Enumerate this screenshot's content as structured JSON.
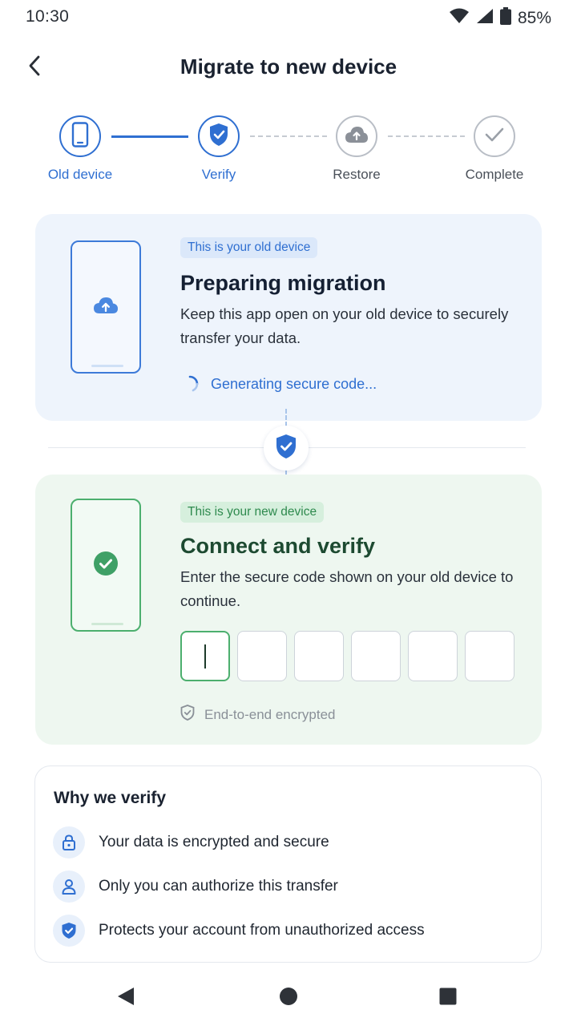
{
  "status_bar": {
    "time": "10:30",
    "battery_percent": "85%",
    "icons": [
      "wifi-icon",
      "signal-icon",
      "battery-icon"
    ]
  },
  "header": {
    "title": "Migrate to new device",
    "back_icon": "chevron-left-icon"
  },
  "stepper": {
    "steps": [
      {
        "label": "Old device",
        "state": "done",
        "icon": "phone-icon"
      },
      {
        "label": "Verify",
        "state": "active",
        "icon": "shield-check-icon"
      },
      {
        "label": "Restore",
        "state": "pending",
        "icon": "cloud-icon"
      },
      {
        "label": "Complete",
        "state": "pending",
        "icon": "check-icon"
      }
    ]
  },
  "old_device_card": {
    "badge": "This is your old device",
    "title": "Preparing migration",
    "description": "Keep this app open on your old device to securely transfer your data.",
    "progress_text": "Generating secure code..."
  },
  "new_device_card": {
    "badge": "This is your new device",
    "title": "Connect and verify",
    "description": "Enter the secure code shown on your old device to continue.",
    "code_length": 6,
    "code_values": [
      "",
      "",
      "",
      "",
      "",
      ""
    ],
    "encryption_note": "End-to-end encrypted"
  },
  "why_verify": {
    "title": "Why we verify",
    "items": [
      {
        "icon": "lock-icon",
        "text": "Your data is encrypted and secure"
      },
      {
        "icon": "user-icon",
        "text": "Only you can authorize this transfer"
      },
      {
        "icon": "shield-check-icon",
        "text": "Protects your account from unauthorized access"
      }
    ]
  },
  "colors": {
    "accent_blue": "#2f6fd1",
    "accent_green": "#4caf6e",
    "old_card_bg": "#eef4fc",
    "new_card_bg": "#eef7f0"
  }
}
